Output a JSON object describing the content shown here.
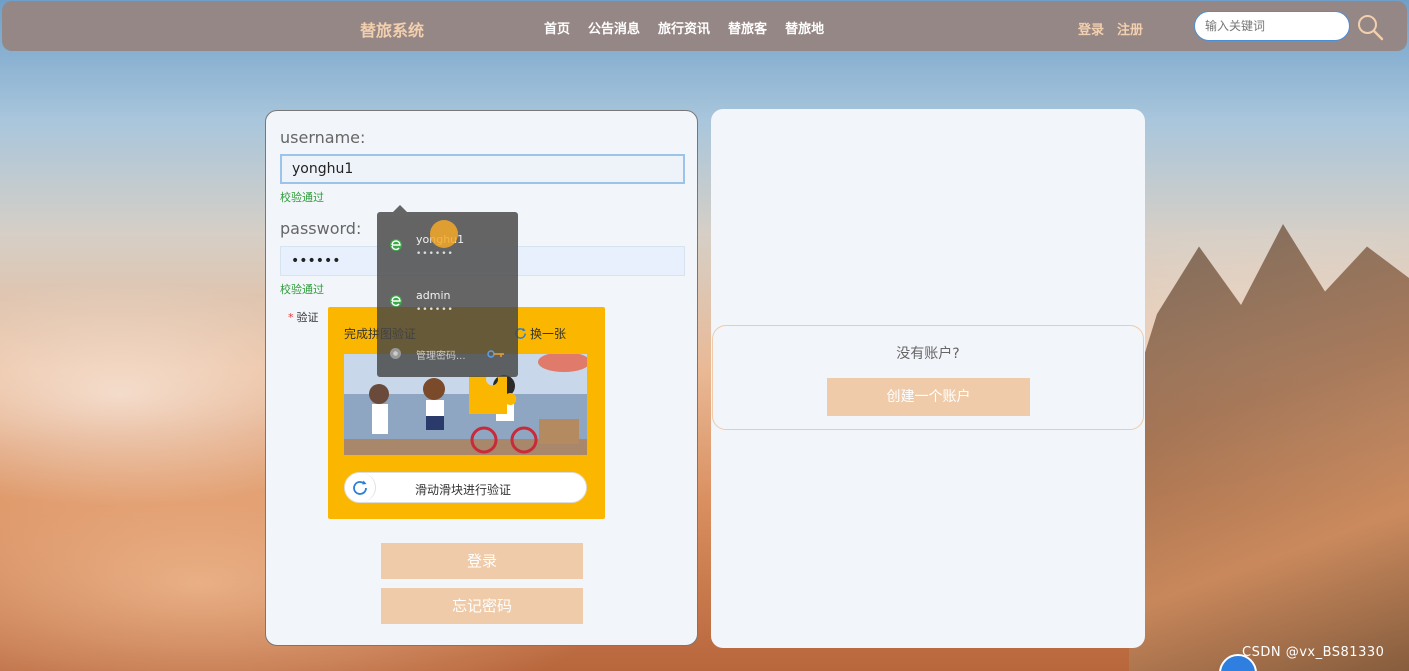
{
  "header": {
    "brand": "替旅系统",
    "nav": [
      "首页",
      "公告消息",
      "旅行资讯",
      "替旅客",
      "替旅地"
    ],
    "login": "登录",
    "register": "注册",
    "search_placeholder": "输入关键词"
  },
  "login_form": {
    "username_label": "username:",
    "username_value": "yonghu1",
    "username_status": "校验通过",
    "password_label": "password:",
    "password_value": "••••••",
    "password_status": "校验通过",
    "verify_label": "验证",
    "captcha_title": "完成拼图验证",
    "captcha_refresh": "换一张",
    "slider_text": "滑动滑块进行验证",
    "login_button": "登录",
    "forgot_button": "忘记密码"
  },
  "autofill": {
    "items": [
      {
        "user": "yonghu1",
        "pass": "••••••"
      },
      {
        "user": "admin",
        "pass": "••••••"
      }
    ],
    "manage": "管理密码..."
  },
  "register_panel": {
    "question": "没有账户?",
    "button": "创建一个账户"
  },
  "watermark": "CSDN @vx_BS81330",
  "colors": {
    "header_bg": "#958785",
    "accent": "#f0cba9",
    "captcha_bg": "#fbb600",
    "valid_green": "#2e9d3a"
  }
}
